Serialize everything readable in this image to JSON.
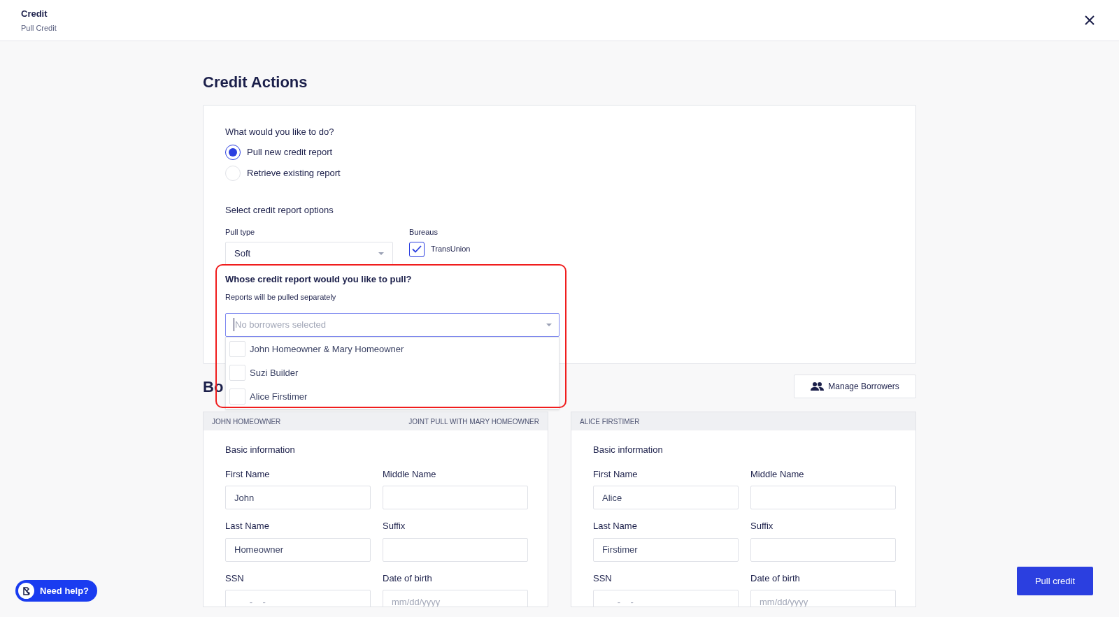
{
  "header": {
    "title": "Credit",
    "subtitle": "Pull Credit"
  },
  "page_title": "Credit Actions",
  "actions": {
    "question": "What would you like to do?",
    "choices": [
      {
        "label": "Pull new credit report",
        "selected": true
      },
      {
        "label": "Retrieve existing report",
        "selected": false
      }
    ],
    "options_heading": "Select credit report options",
    "pull_type": {
      "label": "Pull type",
      "value": "Soft"
    },
    "bureaus": {
      "label": "Bureaus",
      "items": [
        {
          "label": "TransUnion",
          "checked": true
        }
      ]
    },
    "whose": {
      "question": "Whose credit report would you like to pull?",
      "note": "Reports will be pulled separately",
      "placeholder": "No borrowers selected",
      "options": [
        {
          "label": "John Homeowner & Mary Homeowner",
          "checked": false
        },
        {
          "label": "Suzi Builder",
          "checked": false
        },
        {
          "label": "Alice Firstimer",
          "checked": false
        }
      ]
    }
  },
  "borrowers": {
    "heading": "Bo",
    "manage_button": "Manage Borrowers"
  },
  "borrower_cards": [
    {
      "name": "JOHN HOMEOWNER",
      "joint_note": "JOINT PULL WITH MARY HOMEOWNER",
      "section": "Basic information",
      "fields": [
        {
          "label": "First Name",
          "value": "John"
        },
        {
          "label": "Middle Name"
        },
        {
          "label": "Last Name",
          "value": "Homeowner"
        },
        {
          "label": "Suffix"
        },
        {
          "label": "SSN",
          "placeholder": "___-__-____"
        },
        {
          "label": "Date of birth",
          "placeholder": "mm/dd/yyyy"
        }
      ]
    },
    {
      "name": "ALICE FIRSTIMER",
      "section": "Basic information",
      "fields": [
        {
          "label": "First Name",
          "value": "Alice"
        },
        {
          "label": "Middle Name"
        },
        {
          "label": "Last Name",
          "value": "Firstimer"
        },
        {
          "label": "Suffix"
        },
        {
          "label": "SSN",
          "placeholder": "___-__-____"
        },
        {
          "label": "Date of birth",
          "placeholder": "mm/dd/yyyy"
        }
      ]
    }
  ],
  "pull_button": "Pull credit",
  "help_button": "Need help?"
}
